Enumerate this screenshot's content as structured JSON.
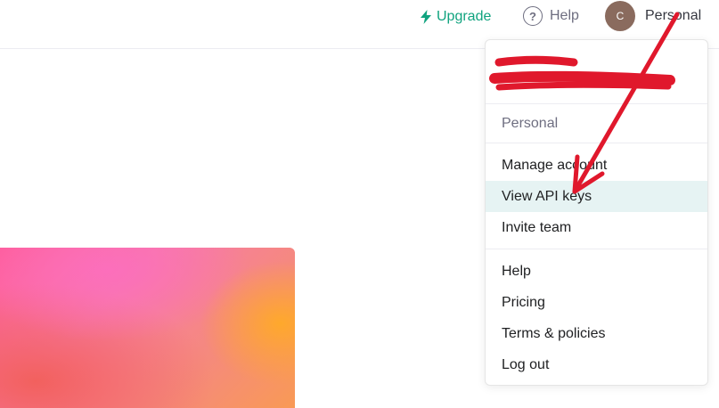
{
  "topbar": {
    "upgrade_label": "Upgrade",
    "help_label": "Help",
    "help_icon_glyph": "?",
    "avatar_initial": "C",
    "account_label": "Personal"
  },
  "menu": {
    "section_label": "Personal",
    "group1": [
      {
        "label": "Manage account"
      },
      {
        "label": "View API keys"
      },
      {
        "label": "Invite team"
      }
    ],
    "group2": [
      {
        "label": "Help"
      },
      {
        "label": "Pricing"
      },
      {
        "label": "Terms & policies"
      },
      {
        "label": "Log out"
      }
    ]
  },
  "colors": {
    "accent": "#10a37f",
    "highlight_row": "#e6f3f3",
    "annotation_red": "#e0182c",
    "avatar_bg": "#8a6b5e"
  },
  "icons": {
    "upgrade": "lightning-bolt-icon",
    "help": "question-circle-icon"
  }
}
